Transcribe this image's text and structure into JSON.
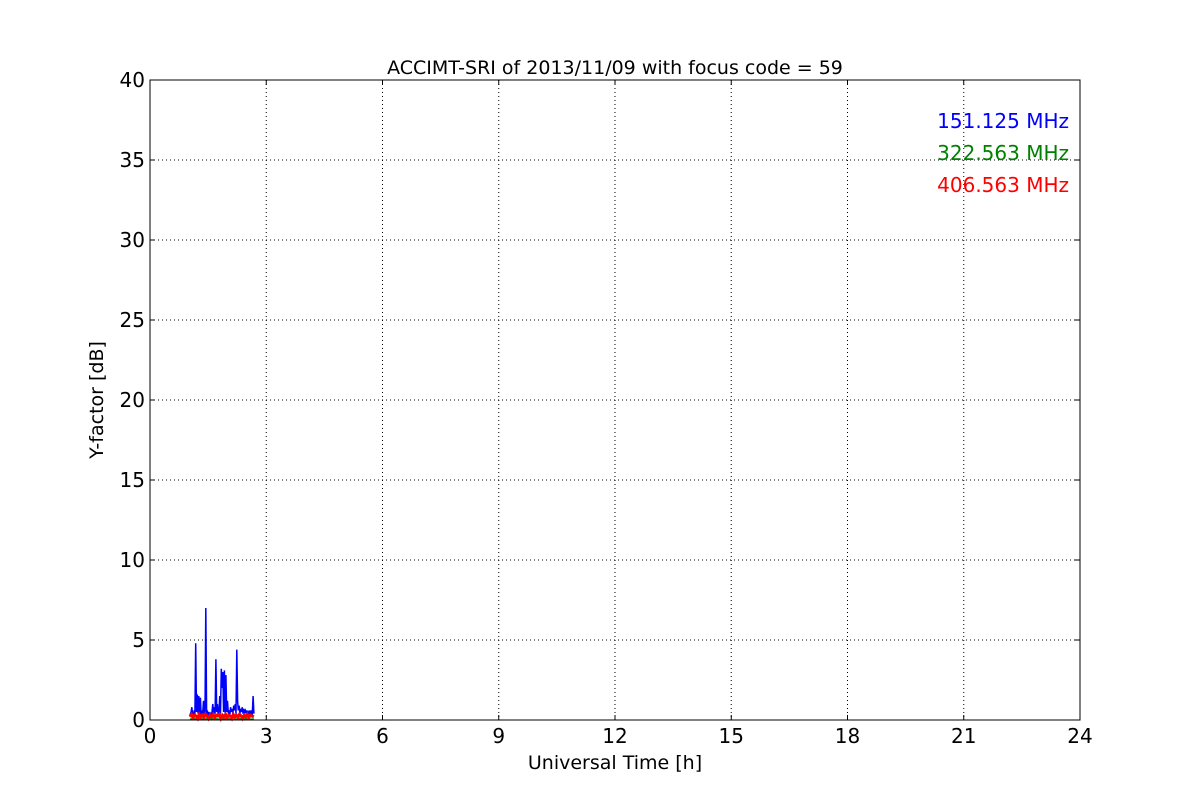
{
  "chart_data": {
    "type": "line",
    "title": "ACCIMT-SRI of 2013/11/09 with focus code = 59",
    "xlabel": "Universal Time [h]",
    "ylabel": "Y-factor [dB]",
    "xlim": [
      0,
      24
    ],
    "ylim": [
      0,
      40
    ],
    "xticks": [
      0,
      3,
      6,
      9,
      12,
      15,
      18,
      21,
      24
    ],
    "yticks": [
      0,
      5,
      10,
      15,
      20,
      25,
      30,
      35,
      40
    ],
    "grid": true,
    "legend_position": "top-right",
    "series": [
      {
        "name": "151.125 MHz",
        "color": "#0000ff",
        "x": [
          1.03,
          1.06,
          1.08,
          1.1,
          1.12,
          1.14,
          1.16,
          1.18,
          1.2,
          1.22,
          1.24,
          1.26,
          1.28,
          1.3,
          1.32,
          1.34,
          1.36,
          1.38,
          1.4,
          1.42,
          1.44,
          1.46,
          1.48,
          1.5,
          1.52,
          1.54,
          1.56,
          1.58,
          1.6,
          1.62,
          1.64,
          1.66,
          1.68,
          1.7,
          1.72,
          1.74,
          1.76,
          1.78,
          1.8,
          1.82,
          1.84,
          1.86,
          1.88,
          1.9,
          1.92,
          1.94,
          1.96,
          1.98,
          2.0,
          2.02,
          2.04,
          2.06,
          2.08,
          2.1,
          2.12,
          2.14,
          2.16,
          2.18,
          2.2,
          2.22,
          2.24,
          2.26,
          2.28,
          2.3,
          2.32,
          2.34,
          2.36,
          2.38,
          2.4,
          2.42,
          2.44,
          2.46,
          2.48,
          2.5,
          2.52,
          2.54,
          2.56,
          2.58,
          2.6,
          2.62,
          2.64,
          2.66,
          2.68
        ],
        "y": [
          0.3,
          0.5,
          0.8,
          0.4,
          0.2,
          0.6,
          0.3,
          4.8,
          0.5,
          1.6,
          0.4,
          1.5,
          0.3,
          1.4,
          0.2,
          0.6,
          0.4,
          1.2,
          0.3,
          0.5,
          7.0,
          0.4,
          0.6,
          0.3,
          0.5,
          0.2,
          0.4,
          0.3,
          0.5,
          1.0,
          0.3,
          0.8,
          0.4,
          3.8,
          0.5,
          1.0,
          0.3,
          0.6,
          1.5,
          0.4,
          3.2,
          2.0,
          3.0,
          0.5,
          3.1,
          0.4,
          2.8,
          0.5,
          1.2,
          0.4,
          0.6,
          0.3,
          0.8,
          0.5,
          0.7,
          0.4,
          0.9,
          0.6,
          1.0,
          0.4,
          4.4,
          1.2,
          0.6,
          0.9,
          0.4,
          0.7,
          0.5,
          0.8,
          0.4,
          0.7,
          0.5,
          0.6,
          0.4,
          0.6,
          0.3,
          0.5,
          0.4,
          0.6,
          0.3,
          0.5,
          0.4,
          1.5,
          0.4
        ]
      },
      {
        "name": "322.563 MHz",
        "color": "#008000",
        "x": [
          1.03,
          1.1,
          1.2,
          1.3,
          1.4,
          1.5,
          1.6,
          1.7,
          1.8,
          1.9,
          2.0,
          2.1,
          2.2,
          2.3,
          2.4,
          2.5,
          2.6,
          2.68
        ],
        "y": [
          0.05,
          0.08,
          0.06,
          0.07,
          0.05,
          0.09,
          0.06,
          0.07,
          0.05,
          0.08,
          0.06,
          0.07,
          0.05,
          0.08,
          0.06,
          0.07,
          0.05,
          0.06
        ]
      },
      {
        "name": "406.563 MHz",
        "color": "#ff0000",
        "x": [
          1.03,
          1.07,
          1.11,
          1.15,
          1.19,
          1.23,
          1.27,
          1.31,
          1.35,
          1.39,
          1.43,
          1.47,
          1.51,
          1.55,
          1.59,
          1.63,
          1.67,
          1.71,
          1.75,
          1.79,
          1.83,
          1.87,
          1.91,
          1.95,
          1.99,
          2.03,
          2.07,
          2.11,
          2.15,
          2.19,
          2.23,
          2.27,
          2.31,
          2.35,
          2.39,
          2.43,
          2.47,
          2.51,
          2.55,
          2.59,
          2.63,
          2.68
        ],
        "y": [
          0.2,
          0.35,
          0.15,
          0.3,
          0.25,
          0.1,
          0.35,
          0.2,
          0.3,
          0.15,
          0.35,
          0.25,
          0.1,
          0.3,
          0.2,
          0.35,
          0.15,
          0.3,
          0.25,
          0.35,
          0.1,
          0.3,
          0.2,
          0.35,
          0.15,
          0.3,
          0.25,
          0.1,
          0.35,
          0.2,
          0.3,
          0.15,
          0.35,
          0.25,
          0.1,
          0.3,
          0.2,
          0.35,
          0.15,
          0.3,
          0.25,
          0.2
        ]
      }
    ]
  }
}
